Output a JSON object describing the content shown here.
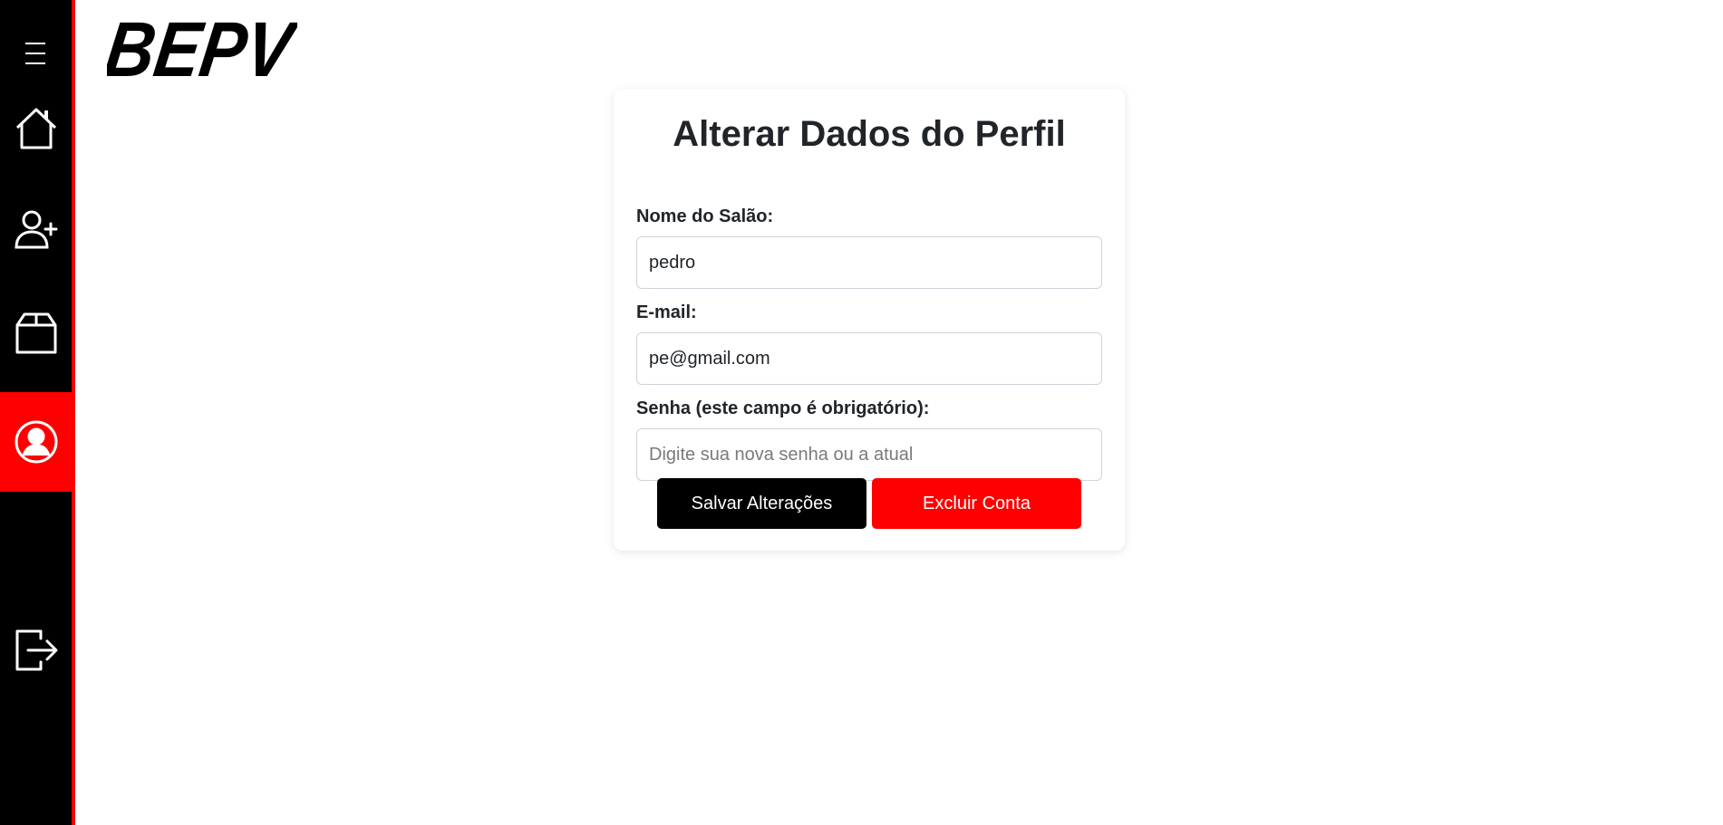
{
  "brand": {
    "logo_text": "BEPV"
  },
  "sidebar": {
    "items": [
      {
        "name": "home",
        "icon": "home-icon"
      },
      {
        "name": "add-user",
        "icon": "user-plus-icon"
      },
      {
        "name": "products",
        "icon": "box-icon"
      },
      {
        "name": "profile",
        "icon": "user-circle-icon",
        "active": true
      },
      {
        "name": "logout",
        "icon": "logout-icon"
      }
    ]
  },
  "form": {
    "title": "Alterar Dados do Perfil",
    "fields": {
      "name": {
        "label": "Nome do Salão:",
        "value": "pedro",
        "placeholder": ""
      },
      "email": {
        "label": "E-mail:",
        "value": "pe@gmail.com",
        "placeholder": ""
      },
      "password": {
        "label": "Senha (este campo é obrigatório):",
        "value": "",
        "placeholder": "Digite sua nova senha ou a atual"
      }
    },
    "save_label": "Salvar Alterações",
    "delete_label": "Excluir Conta"
  },
  "colors": {
    "accent": "#ff0000",
    "sidebar_bg": "#000000",
    "text": "#212529"
  }
}
